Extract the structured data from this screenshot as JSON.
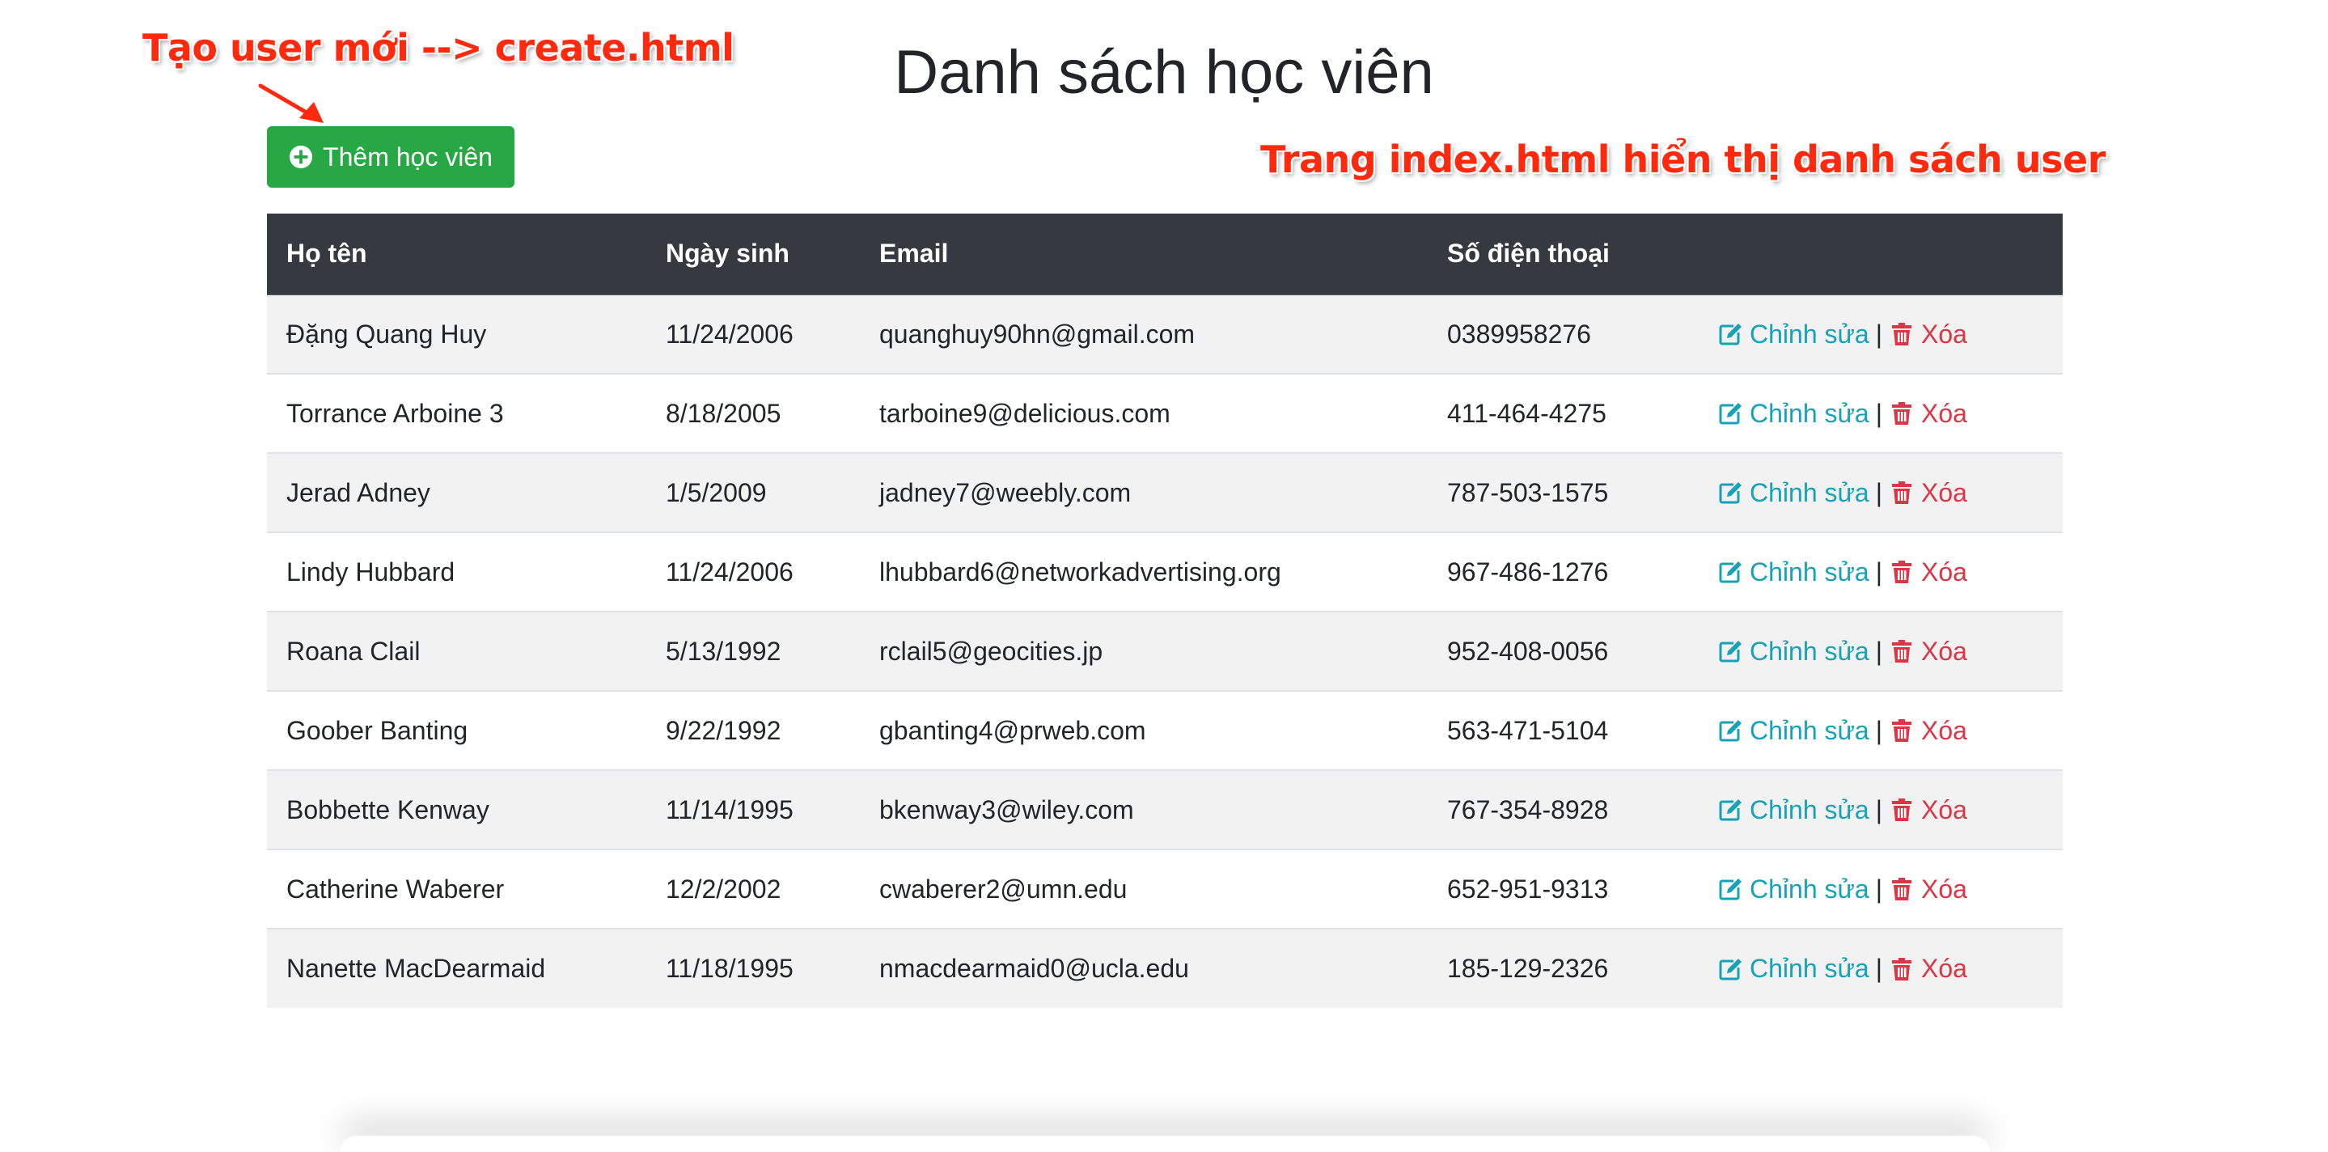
{
  "annotations": {
    "create": "Tạo user mới --> create.html",
    "index": "Trang index.html hiển thị danh sách user"
  },
  "page_title": "Danh sách học viên",
  "add_button_label": "Thêm học viên",
  "columns": {
    "name": "Họ tên",
    "dob": "Ngày sinh",
    "email": "Email",
    "phone": "Số điện thoại",
    "actions": ""
  },
  "actions": {
    "edit_label": "Chỉnh sửa",
    "separator": "|",
    "delete_label": "Xóa"
  },
  "rows": [
    {
      "name": "Đặng Quang Huy",
      "dob": "11/24/2006",
      "email": "quanghuy90hn@gmail.com",
      "phone": "0389958276"
    },
    {
      "name": "Torrance Arboine 3",
      "dob": "8/18/2005",
      "email": "tarboine9@delicious.com",
      "phone": "411-464-4275"
    },
    {
      "name": "Jerad Adney",
      "dob": "1/5/2009",
      "email": "jadney7@weebly.com",
      "phone": "787-503-1575"
    },
    {
      "name": "Lindy Hubbard",
      "dob": "11/24/2006",
      "email": "lhubbard6@networkadvertising.org",
      "phone": "967-486-1276"
    },
    {
      "name": "Roana Clail",
      "dob": "5/13/1992",
      "email": "rclail5@geocities.jp",
      "phone": "952-408-0056"
    },
    {
      "name": "Goober Banting",
      "dob": "9/22/1992",
      "email": "gbanting4@prweb.com",
      "phone": "563-471-5104"
    },
    {
      "name": "Bobbette Kenway",
      "dob": "11/14/1995",
      "email": "bkenway3@wiley.com",
      "phone": "767-354-8928"
    },
    {
      "name": "Catherine Waberer",
      "dob": "12/2/2002",
      "email": "cwaberer2@umn.edu",
      "phone": "652-951-9313"
    },
    {
      "name": "Nanette MacDearmaid",
      "dob": "11/18/1995",
      "email": "nmacdearmaid0@ucla.edu",
      "phone": "185-129-2326"
    }
  ],
  "colors": {
    "success": "#28a745",
    "header_dark": "#343a40",
    "edit": "#17a2b8",
    "delete": "#dc3545",
    "annotation": "#ff2a0e"
  },
  "icons": {
    "add": "plus-circle-icon",
    "edit": "edit-icon",
    "delete": "trash-icon"
  }
}
